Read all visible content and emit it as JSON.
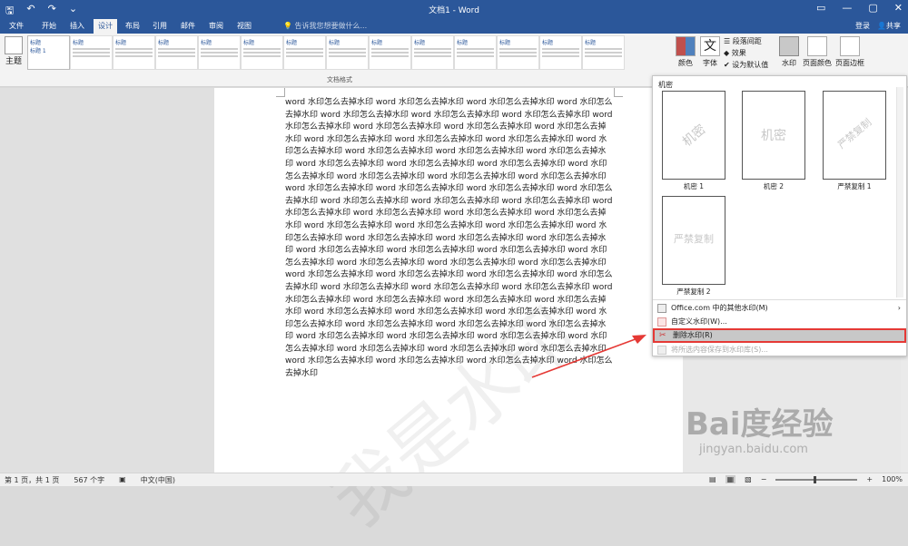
{
  "title": "文档1 - Word",
  "quick_access": {
    "save": "🖫",
    "undo": "↶",
    "redo": "↷",
    "customize": "⌄"
  },
  "window_controls": {
    "restore_ribbon": "▭",
    "minimize": "—",
    "maximize": "▢",
    "close": "✕"
  },
  "tabs": [
    "文件",
    "开始",
    "插入",
    "设计",
    "布局",
    "引用",
    "邮件",
    "审阅",
    "视图"
  ],
  "active_tab": "设计",
  "tell_me": "告诉我您想要做什么...",
  "account": {
    "signin": "登录",
    "share": "共享"
  },
  "ribbon": {
    "theme_label": "主题",
    "style_titles": [
      "标题",
      "标题 1",
      "标题",
      "标题",
      "标题",
      "标题",
      "标题",
      "标题",
      "标题",
      "标题",
      "标题",
      "标题",
      "标题",
      "标题",
      "标题"
    ],
    "section_label": "文档格式",
    "colors_label": "颜色",
    "fonts_label": "字体",
    "paragraph_spacing": "段落间距",
    "effects": "效果",
    "set_default": "设为默认值",
    "watermark_label": "水印",
    "page_color_label": "页面颜色",
    "page_border_label": "页面边框"
  },
  "document": {
    "body": "word 水印怎么去掉水印 word 水印怎么去掉水印 word 水印怎么去掉水印 word 水印怎么去掉水印 word 水印怎么去掉水印 word 水印怎么去掉水印 word 水印怎么去掉水印 word 水印怎么去掉水印 word 水印怎么去掉水印 word 水印怎么去掉水印 word 水印怎么去掉水印 word 水印怎么去掉水印 word 水印怎么去掉水印 word 水印怎么去掉水印 word 水印怎么去掉水印 word 水印怎么去掉水印 word 水印怎么去掉水印 word 水印怎么去掉水印 word 水印怎么去掉水印 word 水印怎么去掉水印 word 水印怎么去掉水印 word 水印怎么去掉水印 word 水印怎么去掉水印 word 水印怎么去掉水印 word 水印怎么去掉水印 word 水印怎么去掉水印 word 水印怎么去掉水印 word 水印怎么去掉水印 word 水印怎么去掉水印 word 水印怎么去掉水印 word 水印怎么去掉水印 word 水印怎么去掉水印 word 水印怎么去掉水印 word 水印怎么去掉水印 word 水印怎么去掉水印 word 水印怎么去掉水印 word 水印怎么去掉水印 word 水印怎么去掉水印 word 水印怎么去掉水印 word 水印怎么去掉水印 word 水印怎么去掉水印 word 水印怎么去掉水印 word 水印怎么去掉水印 word 水印怎么去掉水印 word 水印怎么去掉水印 word 水印怎么去掉水印 word 水印怎么去掉水印 word 水印怎么去掉水印 word 水印怎么去掉水印 word 水印怎么去掉水印 word 水印怎么去掉水印 word 水印怎么去掉水印 word 水印怎么去掉水印 word 水印怎么去掉水印 word 水印怎么去掉水印 word 水印怎么去掉水印 word 水印怎么去掉水印 word 水印怎么去掉水印 word 水印怎么去掉水印 word 水印怎么去掉水印 word 水印怎么去掉水印 word 水印怎么去掉水印 word 水印怎么去掉水印 word 水印怎么去掉水印 word 水印怎么去掉水印 word 水印怎么去掉水印 word 水印怎么去掉水印 word 水印怎么去掉水印 word 水印怎么去掉水印 word 水印怎么去掉水印 word 水印怎么去掉水印 word 水印怎么去掉水印 word 水印怎么去掉水印 word 水印怎么去掉水印 word 水印怎么去掉水印 word 水印怎么去掉水印 word 水印怎么去掉水印 word 水印怎么去掉水印 word 水印怎么去掉水印",
    "watermark_text": "我是水印"
  },
  "watermark_panel": {
    "header": "机密",
    "items": [
      {
        "caption": "机密 1",
        "text": "机密"
      },
      {
        "caption": "机密 2",
        "text": "机密"
      },
      {
        "caption": "严禁复制 1",
        "text": "严禁复制"
      },
      {
        "caption": "严禁复制 2",
        "text": "严禁复制"
      }
    ],
    "menu": {
      "more_watermarks": "Office.com 中的其他水印(M)",
      "custom_watermark": "自定义水印(W)...",
      "remove_watermark": "删除水印(R)",
      "save_selection": "将所选内容保存到水印库(S)..."
    }
  },
  "status": {
    "page": "第 1 页，共 1 页",
    "words": "567 个字",
    "language": "中文(中国)",
    "zoom": "100%"
  },
  "overlay": {
    "baidu_logo": "Bai度经验",
    "baidu_url": "jingyan.baidu.com"
  },
  "colors": {
    "accent": "#2b579a",
    "highlight_border": "#e53935"
  }
}
